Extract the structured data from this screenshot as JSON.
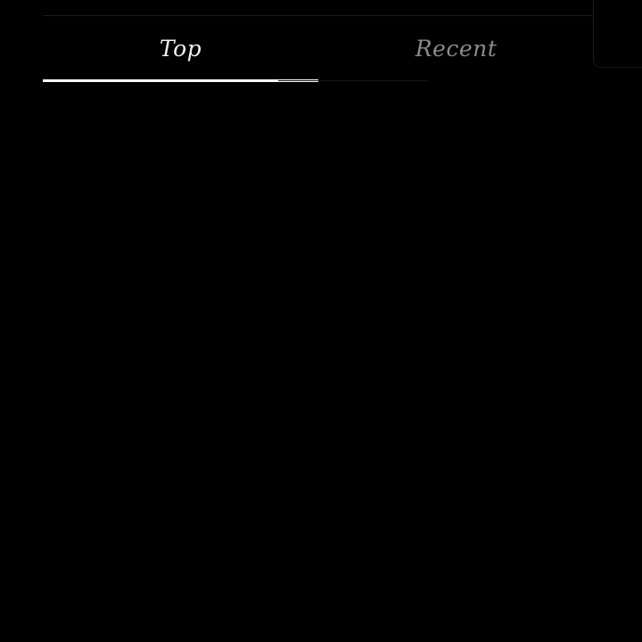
{
  "theme": {
    "background": "#000000",
    "active_text": "#f2f2f2",
    "inactive_text": "#8a8a8a",
    "indicator": "#ffffff"
  },
  "tabs": [
    {
      "label": "Top",
      "selected": true
    },
    {
      "label": "Recent",
      "selected": false
    }
  ]
}
